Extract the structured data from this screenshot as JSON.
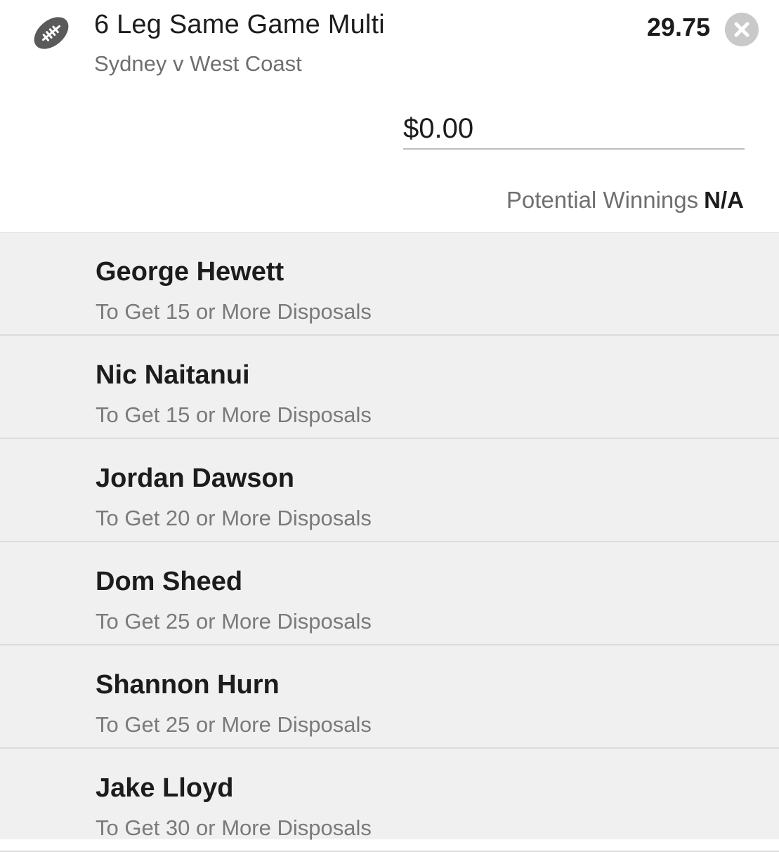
{
  "bet": {
    "icon": "football-icon",
    "title": "6 Leg Same Game Multi",
    "match": "Sydney v West Coast",
    "odds": "29.75",
    "close_icon": "close-icon"
  },
  "stake": {
    "value": "$0.00"
  },
  "winnings": {
    "label": "Potential Winnings",
    "value": "N/A"
  },
  "legs": [
    {
      "player": "George Hewett",
      "market": "To Get 15 or More Disposals"
    },
    {
      "player": "Nic Naitanui",
      "market": "To Get 15 or More Disposals"
    },
    {
      "player": "Jordan Dawson",
      "market": "To Get 20 or More Disposals"
    },
    {
      "player": "Dom Sheed",
      "market": "To Get 25 or More Disposals"
    },
    {
      "player": "Shannon Hurn",
      "market": "To Get 25 or More Disposals"
    },
    {
      "player": "Jake Lloyd",
      "market": "To Get 30 or More Disposals"
    }
  ],
  "colors": {
    "background": "#ffffff",
    "legs_background": "#f0f0f0",
    "text_primary": "#1c1c1c",
    "text_secondary": "#6f6f6f",
    "close_button": "#c9c9c9"
  }
}
